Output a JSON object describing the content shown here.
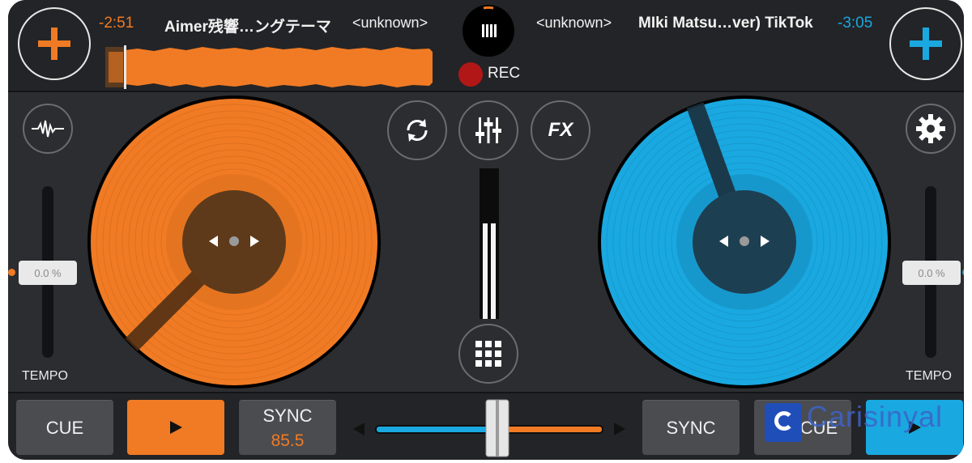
{
  "colors": {
    "left_accent": "#f07b24",
    "right_accent": "#1aa8e0",
    "background": "#2b2d30",
    "rec": "#b11717"
  },
  "top_bar": {
    "left_deck": {
      "add_icon": "plus-icon",
      "time": "-2:51",
      "title": "Aimer残響…ングテーマ",
      "artist": "<unknown>"
    },
    "right_deck": {
      "add_icon": "plus-icon",
      "time": "-3:05",
      "title": "MIki Matsu…ver) TikTok",
      "artist": "<unknown>"
    },
    "center_icon": "vinyl-library-icon",
    "rec_label": "REC"
  },
  "controls": {
    "left_icon": "waveform-icon",
    "right_icon": "gear-icon",
    "loop_icon": "sync-loop-icon",
    "mixer_icon": "mixer-sliders-icon",
    "fx_label": "FX",
    "sampler_icon": "grid-pads-icon"
  },
  "tempo": {
    "left_value": "0.0 %",
    "right_value": "0.0 %",
    "label": "TEMPO"
  },
  "bottom_bar": {
    "left_cue": "CUE",
    "left_play_icon": "play-icon",
    "left_sync": "SYNC",
    "left_bpm": "85.5",
    "right_sync": "SYNC",
    "right_cue": "CUE",
    "right_play_icon": "play-icon",
    "crossfader_position": 0.53
  },
  "watermark": "Carisinyal"
}
